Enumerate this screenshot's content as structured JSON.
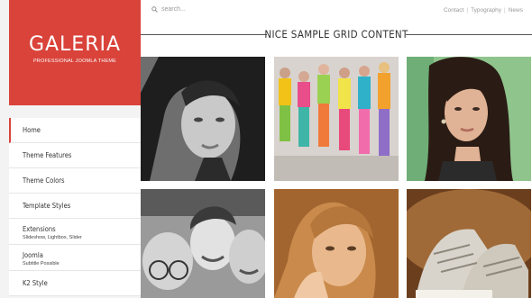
{
  "logo": {
    "title": "GALERIA",
    "subtitle": "PROFESSIONAL JOOMLA THEME"
  },
  "search": {
    "placeholder": "search..."
  },
  "top_links": [
    {
      "label": "Contact"
    },
    {
      "label": "Typography"
    },
    {
      "label": "News"
    }
  ],
  "section_title": "NICE SAMPLE GRID CONTENT",
  "nav": {
    "items": [
      {
        "label": "Home",
        "active": true
      },
      {
        "label": "Theme Features"
      },
      {
        "label": "Theme Colors"
      },
      {
        "label": "Template Styles"
      },
      {
        "label": "Extensions",
        "sub": "Slideshow, Lightbox, Slider"
      },
      {
        "label": "Joomla",
        "sub": "Subtitle Possible"
      },
      {
        "label": "K2 Style"
      }
    ]
  },
  "colors": {
    "accent": "#d9433a",
    "sidebar_bg": "#f3f3f3"
  }
}
